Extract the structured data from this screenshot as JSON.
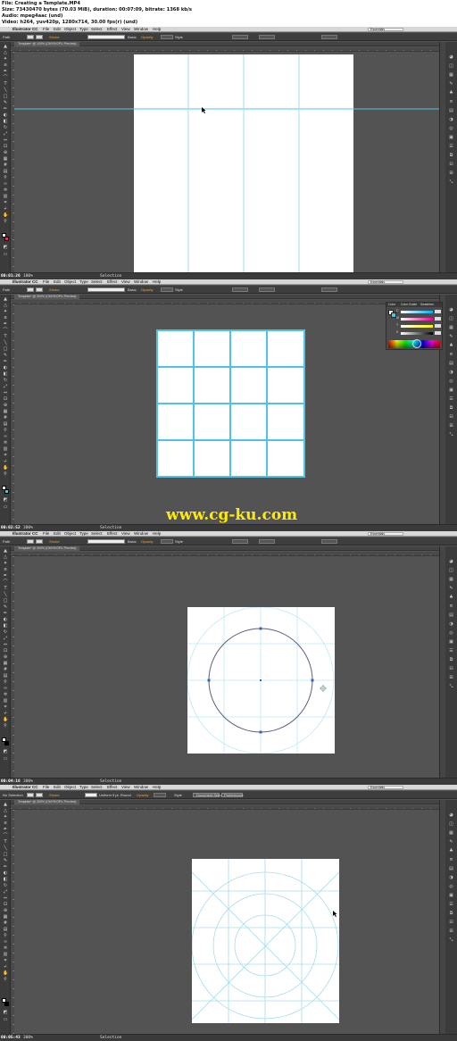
{
  "file_info": {
    "line1": "File: Creating a Template.MP4",
    "line2": "Size: 73430470 bytes (70.03 MiB), duration: 00:07:09, bitrate: 1368 kb/s",
    "line3": "Audio: mpeg4aac (und)",
    "line4": "Video: h264, yuv420p, 1280x714, 30.00 fps(r) (und)"
  },
  "app": {
    "name": "Illustrator CC",
    "menus": [
      "File",
      "Edit",
      "Object",
      "Type",
      "Select",
      "Effect",
      "View",
      "Window",
      "Help"
    ],
    "workspace": "Essentials"
  },
  "control_bar": {
    "selection": "Path",
    "stroke_label": "Stroke",
    "stroke_style": "Basic",
    "opacity_label": "Opacity",
    "style_label": "Style"
  },
  "control_bar_f4": {
    "selection": "No Selection",
    "stroke_style": "Uniform",
    "brush": "5 pt. Round",
    "doc_setup": "Document Setup",
    "preferences": "Preferences"
  },
  "document": {
    "tab": "Template* @ 100% (CMYK/GPU Preview)",
    "tab_f2": "Template* @ 300% (CMYK/GPU Preview)"
  },
  "frames": [
    {
      "timestamp": "00:01:26",
      "zoom": "100%",
      "status": "Selection"
    },
    {
      "timestamp": "00:02:52",
      "zoom": "300%",
      "status": "Selection"
    },
    {
      "timestamp": "00:04:16",
      "zoom": "300%",
      "status": "Selection"
    },
    {
      "timestamp": "00:05:43",
      "zoom": "300%",
      "status": "Selection"
    }
  ],
  "color_panel": {
    "tabs": [
      "Color",
      "Color Guide",
      "Swatches"
    ],
    "channels": [
      "C",
      "M",
      "Y",
      "K"
    ]
  },
  "watermark": "www.cg-ku.com",
  "colors": {
    "guide": "#4fc4e0",
    "canvas": "#535353",
    "panel": "#3b3b3b",
    "watermark": "#ffeb00"
  }
}
